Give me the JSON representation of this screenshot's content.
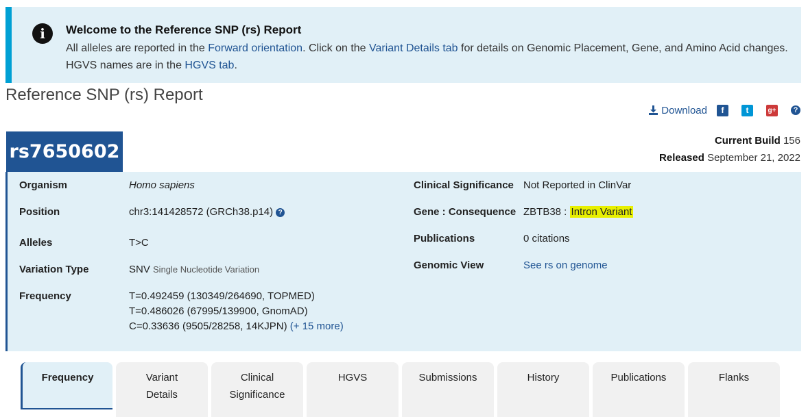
{
  "banner": {
    "title": "Welcome to the Reference SNP (rs) Report",
    "text_1": "All alleles are reported in the ",
    "link_forward": "Forward orientation",
    "text_2": ". Click on the ",
    "link_variant_details": "Variant Details tab",
    "text_3": " for details on Genomic Placement, Gene, and Amino Acid changes. HGVS names are in the ",
    "link_hgvs": "HGVS tab",
    "text_4": "."
  },
  "page_title": "Reference SNP (rs) Report",
  "toolbar": {
    "download_label": "Download",
    "facebook": "f",
    "twitter": "t",
    "google_plus": "g+",
    "help": "?"
  },
  "rs_id": "rs7650602",
  "build": {
    "current_label": "Current Build",
    "current_value": "156",
    "released_label": "Released",
    "released_value": "September 21, 2022"
  },
  "summary": {
    "organism_label": "Organism",
    "organism_value": "Homo sapiens",
    "position_label": "Position",
    "position_value": "chr3:141428572 (GRCh38.p14)",
    "alleles_label": "Alleles",
    "alleles_value": "T>C",
    "variation_type_label": "Variation Type",
    "variation_type_value": "SNV",
    "variation_type_desc": "Single Nucleotide Variation",
    "frequency_label": "Frequency",
    "frequency_lines": [
      "T=0.492459 (130349/264690, TOPMED)",
      "T=0.486026 (67995/139900, GnomAD)",
      "C=0.33636 (9505/28258, 14KJPN)"
    ],
    "frequency_more": "(+ 15 more)",
    "clinical_label": "Clinical Significance",
    "clinical_value": "Not Reported in ClinVar",
    "gene_label": "Gene : Consequence",
    "gene_value": "ZBTB38 :",
    "gene_consequence": "Intron Variant",
    "publications_label": "Publications",
    "publications_value": "0 citations",
    "genomic_view_label": "Genomic View",
    "genomic_view_link": "See rs on genome"
  },
  "tabs": [
    {
      "label_1": "Frequency",
      "label_2": ""
    },
    {
      "label_1": "Variant",
      "label_2": "Details"
    },
    {
      "label_1": "Clinical",
      "label_2": "Significance"
    },
    {
      "label_1": "HGVS",
      "label_2": ""
    },
    {
      "label_1": "Submissions",
      "label_2": ""
    },
    {
      "label_1": "History",
      "label_2": ""
    },
    {
      "label_1": "Publications",
      "label_2": ""
    },
    {
      "label_1": "Flanks",
      "label_2": ""
    }
  ],
  "colors": {
    "accent": "#205493",
    "banner_bg": "#e1f0f7",
    "banner_border": "#00a0d4",
    "highlight": "#e8f000"
  }
}
